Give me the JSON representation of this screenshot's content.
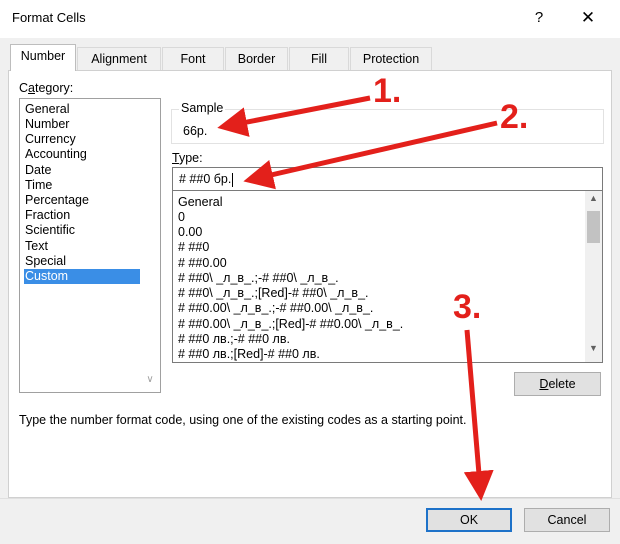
{
  "window": {
    "title": "Format Cells",
    "help_label": "?",
    "close_label": "✕"
  },
  "tabs": [
    {
      "label": "Number",
      "active": true
    },
    {
      "label": "Alignment",
      "active": false
    },
    {
      "label": "Font",
      "active": false
    },
    {
      "label": "Border",
      "active": false
    },
    {
      "label": "Fill",
      "active": false
    },
    {
      "label": "Protection",
      "active": false
    }
  ],
  "category": {
    "label_prefix": "C",
    "label_underlined": "a",
    "label_rest": "tegory:",
    "items": [
      "General",
      "Number",
      "Currency",
      "Accounting",
      "Date",
      "Time",
      "Percentage",
      "Fraction",
      "Scientific",
      "Text",
      "Special",
      "Custom"
    ],
    "selected": "Custom"
  },
  "sample": {
    "label": "Sample",
    "value": "66р."
  },
  "type": {
    "label_underlined": "T",
    "label_rest": "ype:",
    "value": "# ##0 бр."
  },
  "formats": [
    "General",
    "0",
    "0.00",
    "# ##0",
    "# ##0.00",
    "# ##0\\ _л_в_.;-# ##0\\ _л_в_.",
    "# ##0\\ _л_в_.;[Red]-# ##0\\ _л_в_.",
    "# ##0.00\\ _л_в_.;-# ##0.00\\ _л_в_.",
    "# ##0.00\\ _л_в_.;[Red]-# ##0.00\\ _л_в_.",
    "# ##0 лв.;-# ##0 лв.",
    "# ##0 лв.;[Red]-# ##0 лв."
  ],
  "buttons": {
    "delete_underlined": "D",
    "delete_rest": "elete",
    "ok": "OK",
    "cancel": "Cancel"
  },
  "description": "Type the number format code, using one of the existing codes as a starting point.",
  "annotations": {
    "n1": "1.",
    "n2": "2.",
    "n3": "3.",
    "color": "#e3201b"
  },
  "icons": [
    "help-icon",
    "close-icon",
    "scroll-up-icon",
    "scroll-down-icon"
  ]
}
